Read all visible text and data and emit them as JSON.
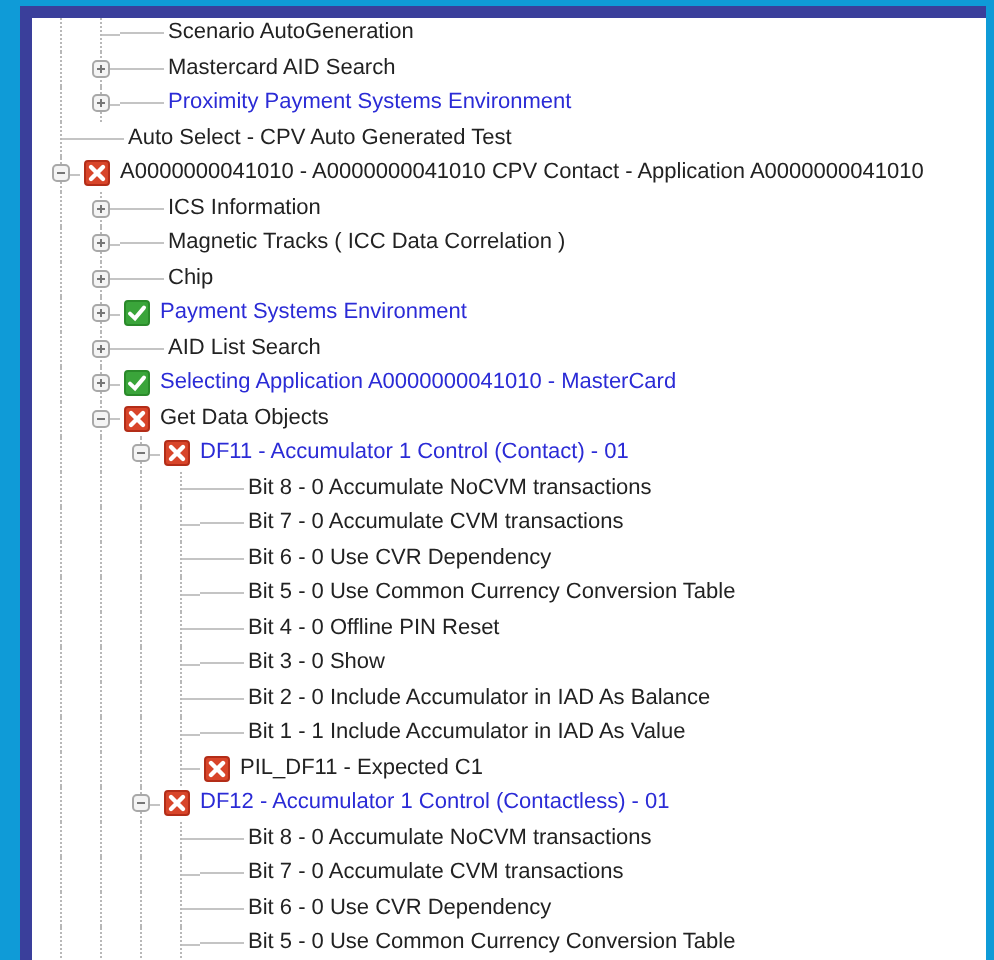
{
  "tree": {
    "partial_branch": [
      {
        "label": "Scenario AutoGeneration"
      },
      {
        "label": "Mastercard AID Search",
        "expanded": false
      },
      {
        "label": "Proximity Payment Systems Environment",
        "expanded": false,
        "color": "#2b2bd6"
      }
    ],
    "items": [
      {
        "label": "Auto Select - CPV Auto Generated Test"
      },
      {
        "label": "A0000000041010 - A0000000041010 CPV Contact - Application A0000000041010",
        "expanded": true,
        "passed": false,
        "children": [
          {
            "label": "ICS Information",
            "expanded": false
          },
          {
            "label": "Magnetic Tracks ( ICC Data Correlation )",
            "expanded": false
          },
          {
            "label": "Chip",
            "expanded": false
          },
          {
            "label": "Payment Systems Environment",
            "expanded": false,
            "passed": true,
            "color": "#2b2bd6"
          },
          {
            "label": "AID List Search",
            "expanded": false
          },
          {
            "label": "Selecting Application A0000000041010 - MasterCard",
            "expanded": false,
            "passed": true,
            "color": "#2b2bd6"
          },
          {
            "label": "Get Data Objects",
            "expanded": true,
            "passed": false,
            "children": [
              {
                "label": "DF11 - Accumulator 1 Control (Contact) - 01",
                "expanded": true,
                "passed": false,
                "color": "#2b2bd6",
                "children": [
                  {
                    "label": "Bit 8 - 0 Accumulate NoCVM transactions"
                  },
                  {
                    "label": "Bit 7 - 0 Accumulate CVM transactions"
                  },
                  {
                    "label": "Bit 6 - 0 Use CVR Dependency"
                  },
                  {
                    "label": "Bit 5 - 0 Use Common Currency Conversion Table"
                  },
                  {
                    "label": "Bit 4 - 0 Offline PIN Reset"
                  },
                  {
                    "label": "Bit 3 - 0 Show"
                  },
                  {
                    "label": "Bit 2 - 0 Include Accumulator in IAD As Balance"
                  },
                  {
                    "label": "Bit 1 - 1 Include Accumulator in IAD As Value"
                  },
                  {
                    "label": "PIL_DF11 - Expected C1",
                    "passed": false
                  }
                ]
              },
              {
                "label": "DF12 - Accumulator 1 Control (Contactless) - 01",
                "expanded": true,
                "passed": false,
                "color": "#2b2bd6",
                "children": [
                  {
                    "label": "Bit 8 - 0 Accumulate NoCVM transactions"
                  },
                  {
                    "label": "Bit 7 - 0 Accumulate CVM transactions"
                  },
                  {
                    "label": "Bit 6 - 0 Use CVR Dependency"
                  },
                  {
                    "label": "Bit 5 - 0 Use Common Currency Conversion Table"
                  }
                ]
              }
            ]
          }
        ]
      }
    ]
  }
}
